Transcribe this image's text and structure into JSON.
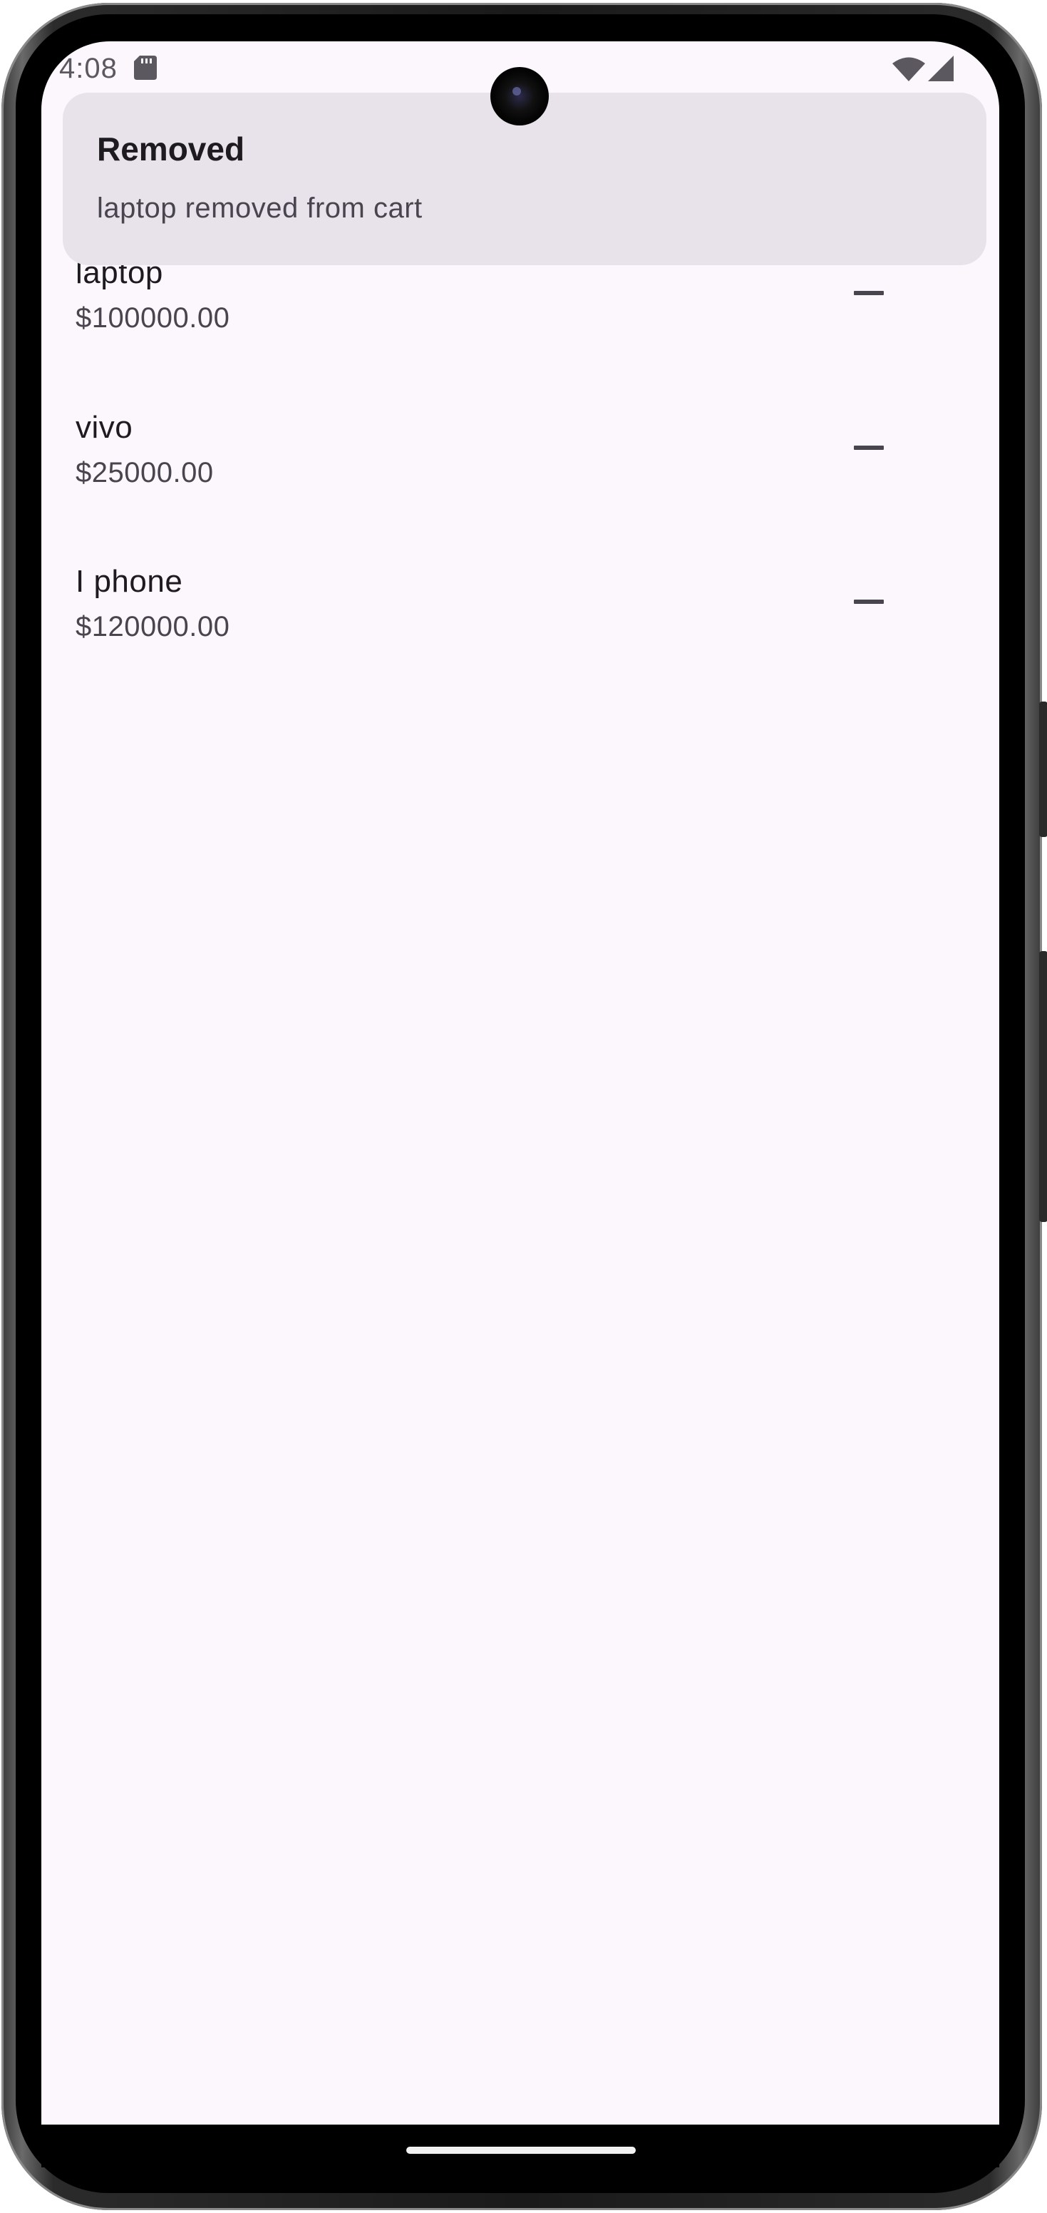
{
  "status_bar": {
    "time": "4:08",
    "icons": [
      "sd-card-icon",
      "wifi-icon",
      "cellular-signal-icon"
    ]
  },
  "snackbar": {
    "title": "Removed",
    "message": "laptop removed from cart"
  },
  "cart": {
    "items": [
      {
        "name": "laptop",
        "price": "$100000.00",
        "action_icon": "remove-icon"
      },
      {
        "name": "vivo",
        "price": "$25000.00",
        "action_icon": "remove-icon"
      },
      {
        "name": "I phone",
        "price": "$120000.00",
        "action_icon": "remove-icon"
      }
    ]
  },
  "colors": {
    "background": "#fcf6fd",
    "snackbar": "#e8e3ea",
    "text_primary": "#1d1b20",
    "text_secondary": "#49454f"
  }
}
